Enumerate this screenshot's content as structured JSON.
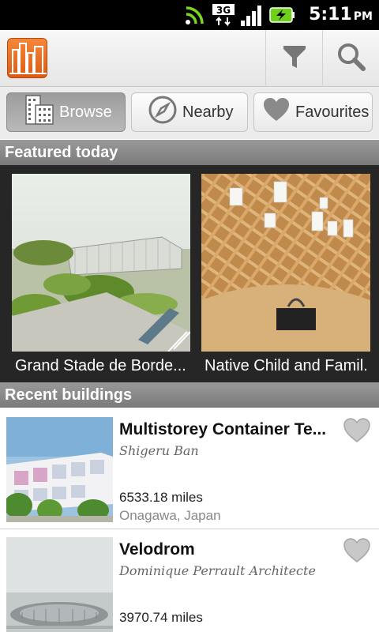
{
  "status_bar": {
    "time": "5:11",
    "ampm": "PM",
    "network": "3G",
    "icons": [
      "wifi-icon",
      "3g-data-icon",
      "signal-icon",
      "battery-charging-icon"
    ]
  },
  "action_bar": {
    "icons": [
      "app-logo-icon",
      "filter-icon",
      "search-icon"
    ]
  },
  "tabs": [
    {
      "label": "Browse",
      "icon": "building-icon",
      "active": true
    },
    {
      "label": "Nearby",
      "icon": "compass-icon",
      "active": false
    },
    {
      "label": "Favourites",
      "icon": "heart-icon",
      "active": false
    }
  ],
  "featured": {
    "header": "Featured today",
    "items": [
      {
        "title": "Grand Stade de Borde..."
      },
      {
        "title": "Native Child and Famil."
      }
    ]
  },
  "recent": {
    "header": "Recent buildings",
    "items": [
      {
        "title": "Multistorey Container Te...",
        "architect": "Shigeru Ban",
        "distance": "6533.18 miles",
        "location": "Onagawa, Japan"
      },
      {
        "title": "Velodrom",
        "architect": "Dominique Perrault Architecte",
        "distance": "3970.74 miles",
        "location": ""
      }
    ]
  },
  "colors": {
    "accent_orange": "#e8631a",
    "tab_active": "#a8a8a8",
    "section_header": "#888888",
    "featured_bg": "#262626"
  }
}
